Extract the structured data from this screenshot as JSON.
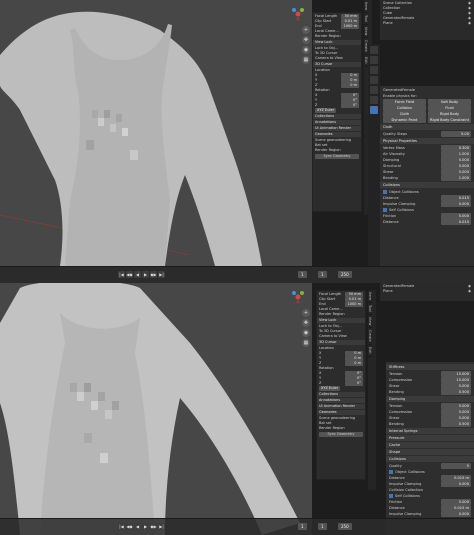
{
  "top": {
    "npanel_view": {
      "focal_length_label": "Focal Length",
      "focal_length": "50 mm",
      "clip_start_label": "Clip Start",
      "clip_start": "0.01 m",
      "end_label": "End",
      "end": "1000 m",
      "local_camera_label": "Local Came...",
      "render_region_label": "Render Region",
      "view_lock_hdr": "View Lock",
      "lock_obj_label": "Lock to Obj...",
      "to_cursor_label": "To 3D Cursor",
      "camera_view_label": "Camera to View"
    },
    "npanel_cursor": {
      "hdr": "3D Cursor",
      "location_label": "Location",
      "x": "X",
      "x_val": "0 m",
      "y": "Y",
      "y_val": "0 m",
      "z": "Z",
      "z_val": "0 m",
      "rotation_label": "Rotation",
      "rx_val": "0°",
      "ry_val": "0°",
      "rz_val": "0°",
      "mode_label": "XYZ Euler",
      "collections": "Collections",
      "annotations": "Annotations",
      "animation_render": "UI Animation Render",
      "geonodes": "Geonodes",
      "scene_label": "Scene geonodeering",
      "set_hdr": "Bat set",
      "frame_label": "Render Region",
      "sync_btn": "Sync Geometry"
    },
    "outliner": {
      "rows": [
        {
          "label": "Scene Collection"
        },
        {
          "label": "Collection"
        },
        {
          "label": "Cube"
        },
        {
          "label": "GeneratedFemale"
        },
        {
          "label": "Plane"
        }
      ]
    },
    "props": {
      "obj_name": "GeneratedFemale",
      "enable_label": "Enable physics for:",
      "physics_buttons": [
        "Force Field",
        "Soft Body",
        "Collision",
        "Fluid",
        "Cloth",
        "Rigid Body",
        "Dynamic Paint",
        "Rigid Body Constraint"
      ],
      "cloth_hdr": "Cloth",
      "quality_label": "Quality Steps",
      "quality_val": "5.00",
      "physical_hdr": "Physical Properties",
      "vertex_mass_label": "Vertex Mass",
      "vertex_mass": "0.300",
      "air_label": "Air Viscosity",
      "air": "1.000",
      "damping_label": "Damping",
      "damping": "5.000",
      "structural_label": "Structural",
      "shear_label": "Shear",
      "bending_label": "Bending",
      "collisions_hdr": "Collisions",
      "object_coll_label": "Object Collisions",
      "distance_label": "Distance",
      "distance": "0.015",
      "impulse_label": "Impulse Clamping",
      "impulse": "0.000",
      "self_coll_label": "Self Collisions",
      "friction_label": "Friction",
      "friction": "5.000",
      "self_distance": "0.015"
    },
    "timeline": {
      "frame_start": "1",
      "frame_current": "1",
      "frame_end": "250"
    }
  },
  "bottom": {
    "npanel_view": {
      "focal_length_label": "Focal Length",
      "focal_length": "50 mm",
      "clip_start_label": "Clip Start",
      "clip_start": "0.01 m",
      "end_label": "End",
      "end": "1000 m",
      "local_camera_label": "Local Came...",
      "render_region_label": "Render Region",
      "view_lock_hdr": "View Lock",
      "lock_obj_label": "Lock to Obj...",
      "to_cursor_label": "To 3D Cursor",
      "camera_view_label": "Camera to View"
    },
    "npanel_cursor": {
      "hdr": "3D Cursor",
      "location_label": "Location",
      "x": "X",
      "x_val": "0 m",
      "y": "Y",
      "y_val": "0 m",
      "z": "Z",
      "z_val": "0 m",
      "rotation_label": "Rotation",
      "rx_val": "0°",
      "ry_val": "0°",
      "rz_val": "0°",
      "mode_label": "XYZ Euler",
      "collections": "Collections",
      "annotations": "Annotations",
      "animation_render": "UI Animation Render",
      "geonodes": "Geonodes",
      "scene_label": "Scene geonodeering",
      "set_hdr": "Bat set",
      "frame_label": "Render Region",
      "sync_btn": "Sync Geometry"
    },
    "outliner": {
      "rows": [
        {
          "label": "GeneratedFemale"
        },
        {
          "label": "Plane"
        }
      ]
    },
    "props": {
      "stiffness_hdr": "Stiffness",
      "tension_label": "Tension",
      "tension": "15.000",
      "compression_label": "Compression",
      "compression": "15.000",
      "shear_label": "Shear",
      "shear": "5.000",
      "bending_label": "Bending",
      "bending": "0.500",
      "damping_hdr": "Damping",
      "d_tension": "5.000",
      "d_compression": "5.000",
      "d_shear": "5.000",
      "d_bending": "0.500",
      "internal_hdr": "Internal Springs",
      "pressure_hdr": "Pressure",
      "cache_hdr": "Cache",
      "shape_hdr": "Shape",
      "collisions_hdr": "Collisions",
      "quality_label": "Quality",
      "quality": "5",
      "object_coll_label": "Object Collisions",
      "distance_label": "Distance",
      "distance": "0.015 m",
      "impulse_label": "Impulse Clamping",
      "impulse": "0.000",
      "collection_label": "Collision Collection",
      "self_coll_label": "Self Collisions",
      "friction_label": "Friction",
      "friction": "5.000",
      "self_distance": "0.015 m",
      "self_impulse": "0.000"
    },
    "timeline": {
      "frame_start": "1",
      "frame_current": "1",
      "frame_end": "250"
    }
  },
  "tabs": [
    "Item",
    "Tool",
    "View",
    "Create",
    "Edit"
  ],
  "transport_icons": [
    "jump-start-icon",
    "prev-key-icon",
    "play-reverse-icon",
    "play-icon",
    "next-key-icon",
    "jump-end-icon"
  ],
  "transport_glyphs": [
    "|◀",
    "◀◆",
    "◀",
    "▶",
    "◆▶",
    "▶|"
  ],
  "colors": {
    "viewport_bg": "#474747",
    "panel_bg": "#2c2c2c",
    "accent": "#4772b3",
    "mesh": "#bcbcbc"
  }
}
